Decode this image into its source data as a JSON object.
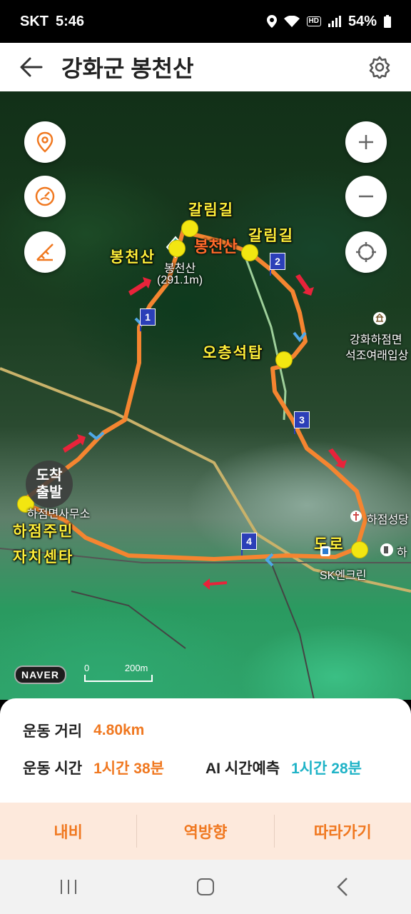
{
  "status_bar": {
    "carrier": "SKT",
    "time": "5:46",
    "hd": "HD",
    "battery": "54%"
  },
  "header": {
    "title": "강화군 봉천산",
    "back_icon": "arrow-left-icon",
    "settings_icon": "gear-icon"
  },
  "map": {
    "peak": {
      "name": "봉천산",
      "caption_name": "봉천산",
      "caption_height": "(291.1m)"
    },
    "labels": {
      "galim1": "갈림길",
      "galim2": "갈림길",
      "bongcheonsan": "봉천산",
      "ocheung": "오층석탑",
      "doro": "도로",
      "hajeom1": "하점주민",
      "hajeom2": "자치센타"
    },
    "pois": {
      "gwahwa1": "강화하점면",
      "gwahwa2": "석조여래입상",
      "church": "하점성당",
      "edge": "하",
      "sk": "SK엔크린",
      "office": "하점면사무소"
    },
    "waypoints": [
      "1",
      "2",
      "3",
      "4"
    ],
    "arrive": {
      "line1": "도착",
      "line2": "출발"
    },
    "naver": "NAVER",
    "scale": {
      "zero": "0",
      "dist": "200m"
    },
    "route_color": "#f58530"
  },
  "stats": {
    "distance_label": "운동 거리",
    "distance_value": "4.80km",
    "time_label": "운동 시간",
    "time_value": "1시간 38분",
    "ai_label": "AI 시간예측",
    "ai_value": "1시간 28분"
  },
  "actions": {
    "navi": "내비",
    "reverse": "역방향",
    "follow": "따라가기"
  }
}
